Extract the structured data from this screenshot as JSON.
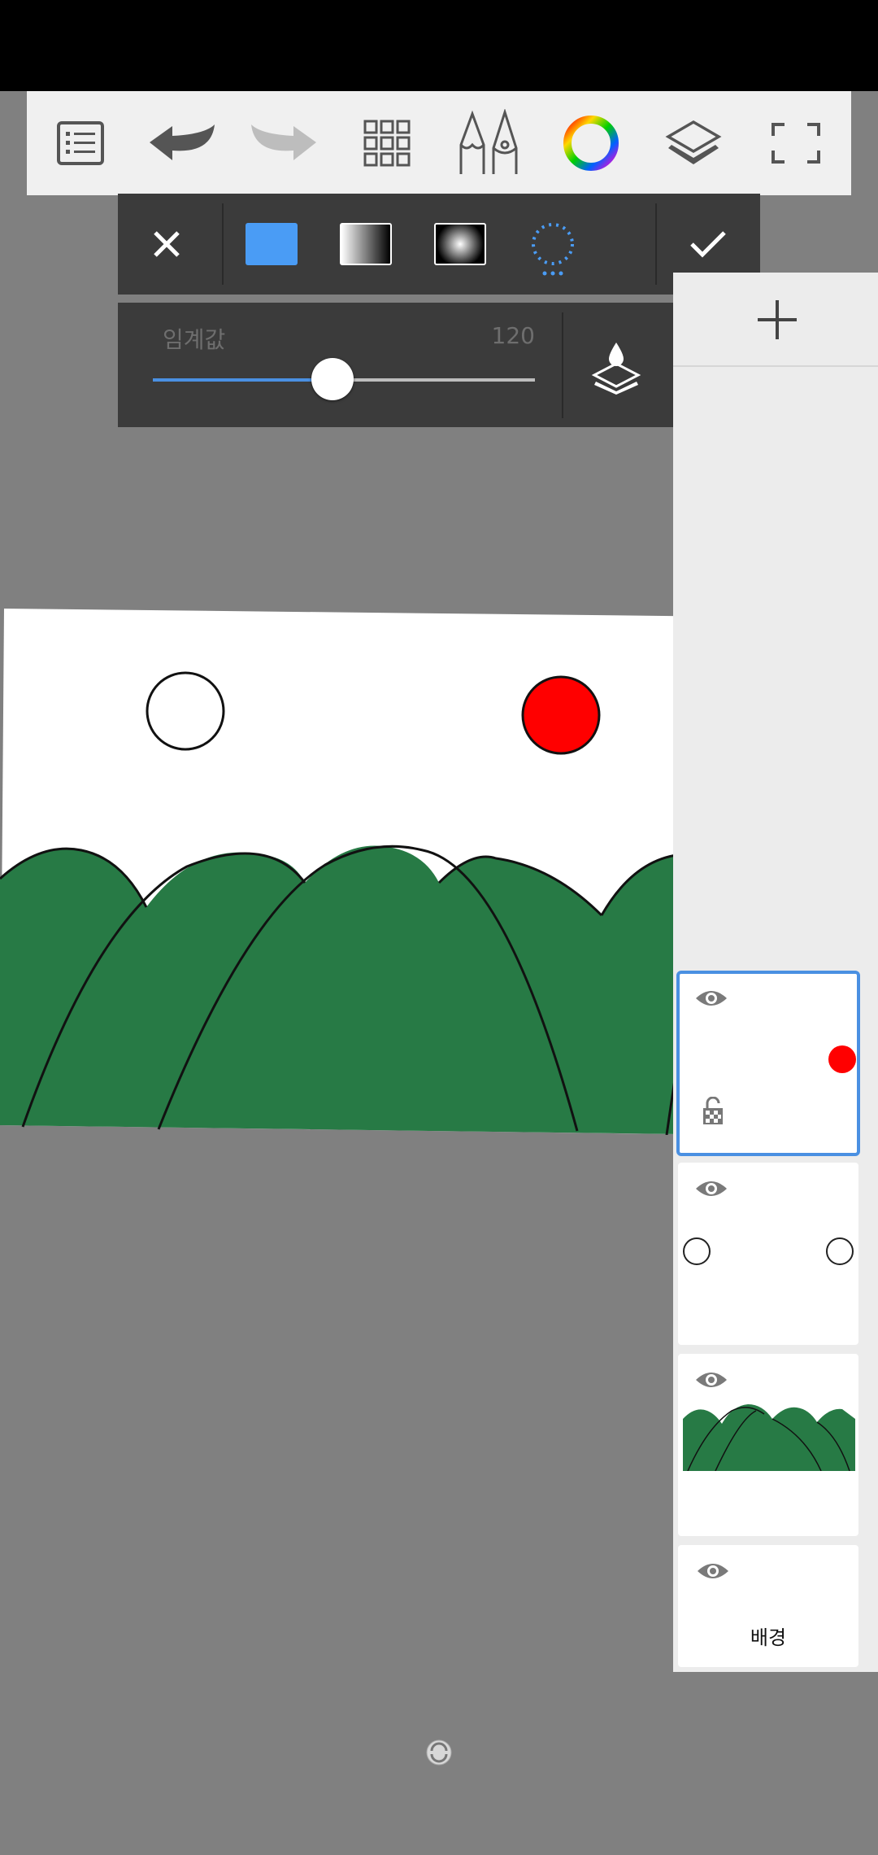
{
  "toolbar": {
    "buttons": [
      "list-icon",
      "undo-icon",
      "redo-icon",
      "grid-icon",
      "brush-pen-icon",
      "color-wheel-icon",
      "layers-icon",
      "fullscreen-icon"
    ]
  },
  "fill_options": {
    "selected": "solid-fill",
    "modes": [
      "solid-fill",
      "linear-gradient",
      "radial-gradient",
      "magic-select"
    ]
  },
  "threshold": {
    "label": "임계값",
    "value": "120",
    "fraction": 0.47
  },
  "layers": {
    "items": [
      {
        "name": "",
        "selected": true
      },
      {
        "name": "",
        "selected": false
      },
      {
        "name": "",
        "selected": false
      },
      {
        "name": "배경",
        "selected": false
      }
    ]
  },
  "colors": {
    "accent": "#4a90e2",
    "panel": "#3b3b3b",
    "hill": "#277a45",
    "sun": "#ff0000"
  }
}
